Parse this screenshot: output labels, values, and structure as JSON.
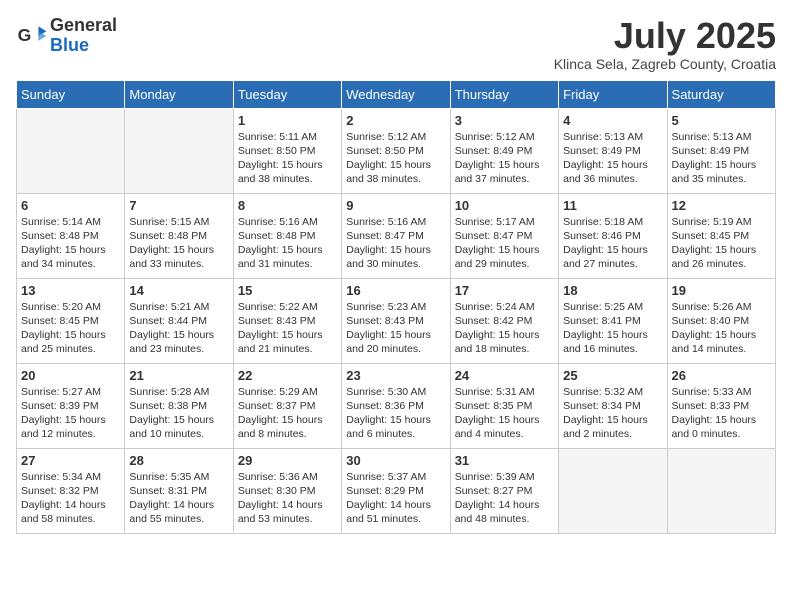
{
  "header": {
    "logo_general": "General",
    "logo_blue": "Blue",
    "month_title": "July 2025",
    "location": "Klinca Sela, Zagreb County, Croatia"
  },
  "days_of_week": [
    "Sunday",
    "Monday",
    "Tuesday",
    "Wednesday",
    "Thursday",
    "Friday",
    "Saturday"
  ],
  "weeks": [
    [
      {
        "day": "",
        "info": ""
      },
      {
        "day": "",
        "info": ""
      },
      {
        "day": "1",
        "info": "Sunrise: 5:11 AM\nSunset: 8:50 PM\nDaylight: 15 hours and 38 minutes."
      },
      {
        "day": "2",
        "info": "Sunrise: 5:12 AM\nSunset: 8:50 PM\nDaylight: 15 hours and 38 minutes."
      },
      {
        "day": "3",
        "info": "Sunrise: 5:12 AM\nSunset: 8:49 PM\nDaylight: 15 hours and 37 minutes."
      },
      {
        "day": "4",
        "info": "Sunrise: 5:13 AM\nSunset: 8:49 PM\nDaylight: 15 hours and 36 minutes."
      },
      {
        "day": "5",
        "info": "Sunrise: 5:13 AM\nSunset: 8:49 PM\nDaylight: 15 hours and 35 minutes."
      }
    ],
    [
      {
        "day": "6",
        "info": "Sunrise: 5:14 AM\nSunset: 8:48 PM\nDaylight: 15 hours and 34 minutes."
      },
      {
        "day": "7",
        "info": "Sunrise: 5:15 AM\nSunset: 8:48 PM\nDaylight: 15 hours and 33 minutes."
      },
      {
        "day": "8",
        "info": "Sunrise: 5:16 AM\nSunset: 8:48 PM\nDaylight: 15 hours and 31 minutes."
      },
      {
        "day": "9",
        "info": "Sunrise: 5:16 AM\nSunset: 8:47 PM\nDaylight: 15 hours and 30 minutes."
      },
      {
        "day": "10",
        "info": "Sunrise: 5:17 AM\nSunset: 8:47 PM\nDaylight: 15 hours and 29 minutes."
      },
      {
        "day": "11",
        "info": "Sunrise: 5:18 AM\nSunset: 8:46 PM\nDaylight: 15 hours and 27 minutes."
      },
      {
        "day": "12",
        "info": "Sunrise: 5:19 AM\nSunset: 8:45 PM\nDaylight: 15 hours and 26 minutes."
      }
    ],
    [
      {
        "day": "13",
        "info": "Sunrise: 5:20 AM\nSunset: 8:45 PM\nDaylight: 15 hours and 25 minutes."
      },
      {
        "day": "14",
        "info": "Sunrise: 5:21 AM\nSunset: 8:44 PM\nDaylight: 15 hours and 23 minutes."
      },
      {
        "day": "15",
        "info": "Sunrise: 5:22 AM\nSunset: 8:43 PM\nDaylight: 15 hours and 21 minutes."
      },
      {
        "day": "16",
        "info": "Sunrise: 5:23 AM\nSunset: 8:43 PM\nDaylight: 15 hours and 20 minutes."
      },
      {
        "day": "17",
        "info": "Sunrise: 5:24 AM\nSunset: 8:42 PM\nDaylight: 15 hours and 18 minutes."
      },
      {
        "day": "18",
        "info": "Sunrise: 5:25 AM\nSunset: 8:41 PM\nDaylight: 15 hours and 16 minutes."
      },
      {
        "day": "19",
        "info": "Sunrise: 5:26 AM\nSunset: 8:40 PM\nDaylight: 15 hours and 14 minutes."
      }
    ],
    [
      {
        "day": "20",
        "info": "Sunrise: 5:27 AM\nSunset: 8:39 PM\nDaylight: 15 hours and 12 minutes."
      },
      {
        "day": "21",
        "info": "Sunrise: 5:28 AM\nSunset: 8:38 PM\nDaylight: 15 hours and 10 minutes."
      },
      {
        "day": "22",
        "info": "Sunrise: 5:29 AM\nSunset: 8:37 PM\nDaylight: 15 hours and 8 minutes."
      },
      {
        "day": "23",
        "info": "Sunrise: 5:30 AM\nSunset: 8:36 PM\nDaylight: 15 hours and 6 minutes."
      },
      {
        "day": "24",
        "info": "Sunrise: 5:31 AM\nSunset: 8:35 PM\nDaylight: 15 hours and 4 minutes."
      },
      {
        "day": "25",
        "info": "Sunrise: 5:32 AM\nSunset: 8:34 PM\nDaylight: 15 hours and 2 minutes."
      },
      {
        "day": "26",
        "info": "Sunrise: 5:33 AM\nSunset: 8:33 PM\nDaylight: 15 hours and 0 minutes."
      }
    ],
    [
      {
        "day": "27",
        "info": "Sunrise: 5:34 AM\nSunset: 8:32 PM\nDaylight: 14 hours and 58 minutes."
      },
      {
        "day": "28",
        "info": "Sunrise: 5:35 AM\nSunset: 8:31 PM\nDaylight: 14 hours and 55 minutes."
      },
      {
        "day": "29",
        "info": "Sunrise: 5:36 AM\nSunset: 8:30 PM\nDaylight: 14 hours and 53 minutes."
      },
      {
        "day": "30",
        "info": "Sunrise: 5:37 AM\nSunset: 8:29 PM\nDaylight: 14 hours and 51 minutes."
      },
      {
        "day": "31",
        "info": "Sunrise: 5:39 AM\nSunset: 8:27 PM\nDaylight: 14 hours and 48 minutes."
      },
      {
        "day": "",
        "info": ""
      },
      {
        "day": "",
        "info": ""
      }
    ]
  ]
}
